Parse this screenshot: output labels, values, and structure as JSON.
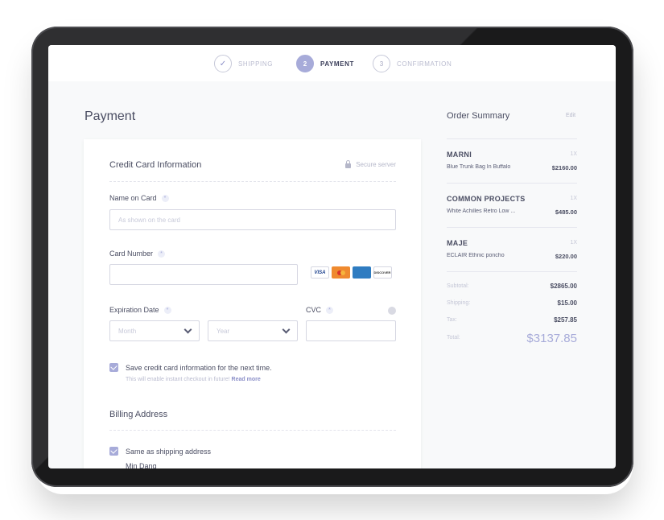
{
  "steps": [
    {
      "label": "SHIPPING",
      "badge": "✓"
    },
    {
      "label": "PAYMENT",
      "badge": "2"
    },
    {
      "label": "CONFIRMATION",
      "badge": "3"
    }
  ],
  "page_title": "Payment",
  "card_section": {
    "title": "Credit Card Information",
    "secure_label": "Secure server",
    "required_mark": "*",
    "name_label": "Name on Card",
    "name_placeholder": "As shown on the card",
    "number_label": "Card Number",
    "number_value": "",
    "expiration_label": "Expiration Date",
    "month_placeholder": "Month",
    "year_placeholder": "Year",
    "cvc_label": "CVC",
    "cvc_value": "",
    "card_brands": [
      "VISA",
      "",
      "",
      "DISCOVER"
    ]
  },
  "save_card": {
    "label": "Save credit card information for the next time.",
    "sub": "This will enable instant checkout in future!",
    "link": "Read more"
  },
  "billing": {
    "title": "Billing Address",
    "same_as_label": "Same as shipping address",
    "name_cut": "Min Dang"
  },
  "summary": {
    "title": "Order Summary",
    "edit": "Edit",
    "items": [
      {
        "brand": "MARNI",
        "qty": "1X",
        "name": "Blue Trunk Bag In Buffalo",
        "price": "$2160.00"
      },
      {
        "brand": "COMMON PROJECTS",
        "qty": "1X",
        "name": "White Achilles Retro Low ...",
        "price": "$485.00"
      },
      {
        "brand": "MAJE",
        "qty": "1X",
        "name": "ECLAIR Ethnic poncho",
        "price": "$220.00"
      }
    ],
    "subtotal_label": "Subtotal:",
    "subtotal": "$2865.00",
    "shipping_label": "Shipping:",
    "shipping": "$15.00",
    "tax_label": "Tax:",
    "tax": "$257.85",
    "total_label": "Total:",
    "total": "$3137.85"
  }
}
